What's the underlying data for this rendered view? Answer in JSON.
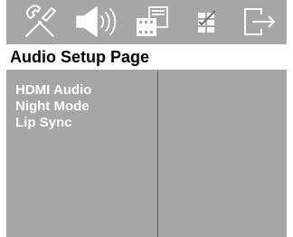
{
  "tabs": [
    {
      "icon": "tools-icon",
      "label": "General Setup"
    },
    {
      "icon": "speaker-icon",
      "label": "Audio Setup"
    },
    {
      "icon": "film-icon",
      "label": "Video Setup"
    },
    {
      "icon": "preferences-icon",
      "label": "Preference Setup"
    },
    {
      "icon": "exit-icon",
      "label": "Exit"
    }
  ],
  "page": {
    "title": "Audio Setup Page"
  },
  "menu": {
    "items": [
      {
        "label": "HDMI Audio"
      },
      {
        "label": "Night Mode"
      },
      {
        "label": "Lip Sync"
      }
    ]
  },
  "colors": {
    "background": "#a6a6a6",
    "title_bar": "#ffffff",
    "title_text": "#000000",
    "menu_text": "#ffffff",
    "icon": "#ffffff"
  }
}
